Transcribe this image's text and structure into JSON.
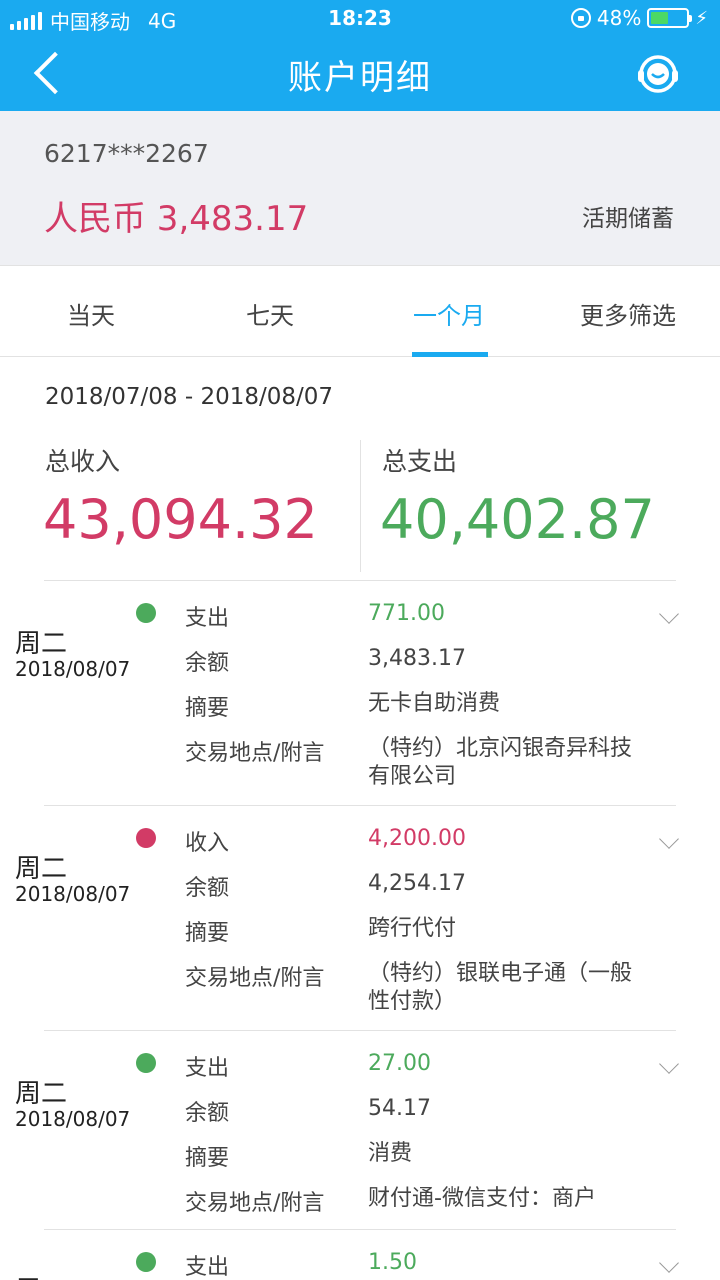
{
  "status_bar": {
    "carrier": "中国移动",
    "network": "4G",
    "time": "18:23",
    "battery_percent": "48%",
    "battery_level": 0.48
  },
  "nav": {
    "title": "账户明细"
  },
  "account": {
    "number": "6217***2267",
    "balance": "人民币 3,483.17",
    "type": "活期储蓄"
  },
  "tabs": [
    "当天",
    "七天",
    "一个月",
    "更多筛选"
  ],
  "active_tab": "一个月",
  "summary": {
    "date_range": "2018/07/08 - 2018/08/07",
    "income_label": "总收入",
    "income_value": "43,094.32",
    "expense_label": "总支出",
    "expense_value": "40,402.87"
  },
  "field_labels": {
    "balance": "余额",
    "summary": "摘要",
    "location": "交易地点/附言"
  },
  "transactions": [
    {
      "weekday": "周二",
      "date": "2018/08/07",
      "dot_color": "#4caa5c",
      "type": "支出",
      "amount": "771.00",
      "amount_color": "#4caa5c",
      "balance": "3,483.17",
      "summary": "无卡自助消费",
      "location": "（特约）北京闪银奇异科技有限公司"
    },
    {
      "weekday": "周二",
      "date": "2018/08/07",
      "dot_color": "#d23b66",
      "type": "收入",
      "amount": "4,200.00",
      "amount_color": "#d23b66",
      "balance": "4,254.17",
      "summary": "跨行代付",
      "location": "（特约）银联电子通（一般性付款）"
    },
    {
      "weekday": "周二",
      "date": "2018/08/07",
      "dot_color": "#4caa5c",
      "type": "支出",
      "amount": "27.00",
      "amount_color": "#4caa5c",
      "balance": "54.17",
      "summary": "消费",
      "location": "财付通-微信支付：商户"
    },
    {
      "weekday": "周",
      "date": "",
      "dot_color": "#4caa5c",
      "type": "支出",
      "amount": "1.50",
      "amount_color": "#4caa5c",
      "balance": "",
      "summary": "",
      "location": ""
    }
  ],
  "colors": {
    "brand": "#1aaaf0",
    "income": "#d23b66",
    "expense": "#4caa5c"
  }
}
